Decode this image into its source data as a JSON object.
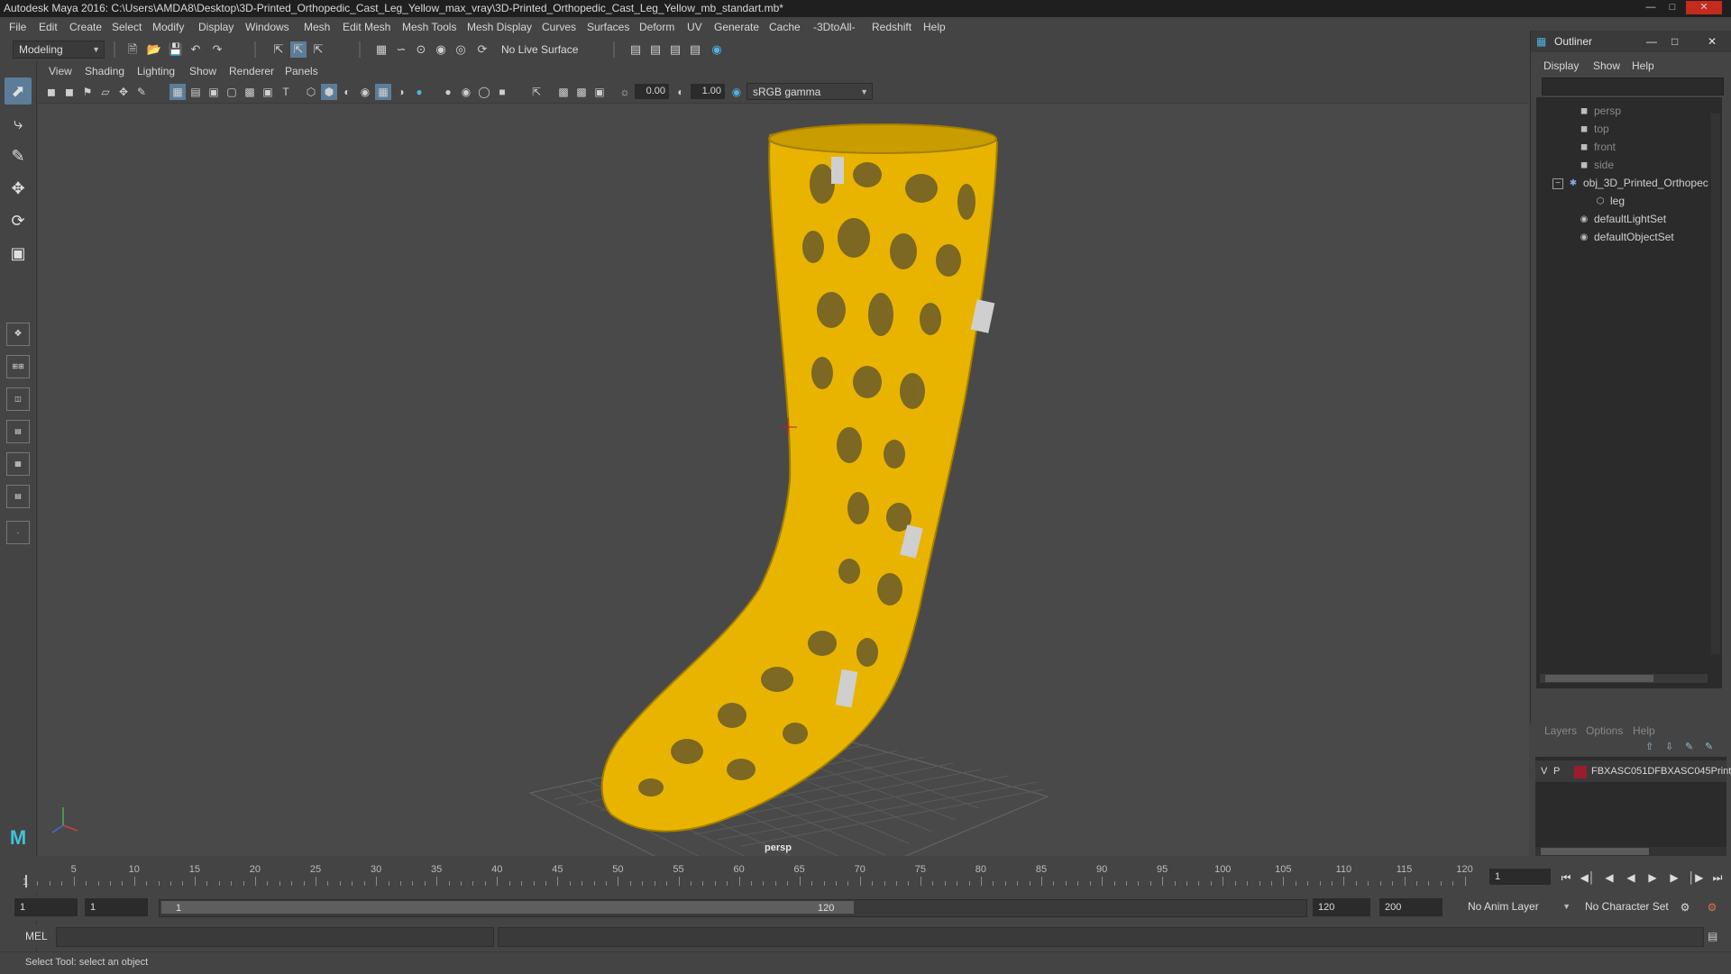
{
  "window": {
    "title": "Autodesk Maya 2016: C:\\Users\\AMDA8\\Desktop\\3D-Printed_Orthopedic_Cast_Leg_Yellow_max_vray\\3D-Printed_Orthopedic_Cast_Leg_Yellow_mb_standart.mb*"
  },
  "menu": [
    "File",
    "Edit",
    "Create",
    "Select",
    "Modify",
    "Display",
    "Windows",
    "Mesh",
    "Edit Mesh",
    "Mesh Tools",
    "Mesh Display",
    "Curves",
    "Surfaces",
    "Deform",
    "UV",
    "Generate",
    "Cache",
    "-3DtoAll-",
    "Redshift",
    "Help"
  ],
  "statusline": {
    "mode": "Modeling",
    "live_surface": "No Live Surface"
  },
  "viewport": {
    "menu": [
      "View",
      "Shading",
      "Lighting",
      "Show",
      "Renderer",
      "Panels"
    ],
    "exposure": "0.00",
    "gamma": "1.00",
    "color_space": "sRGB gamma",
    "camera": "persp",
    "model_color": "#e8b400"
  },
  "outliner": {
    "title": "Outliner",
    "menu": [
      "Display",
      "Show",
      "Help"
    ],
    "items": [
      {
        "label": "persp",
        "icon": "camera-icon",
        "dim": true
      },
      {
        "label": "top",
        "icon": "camera-icon",
        "dim": true
      },
      {
        "label": "front",
        "icon": "camera-icon",
        "dim": true
      },
      {
        "label": "side",
        "icon": "camera-icon",
        "dim": true
      },
      {
        "label": "obj_3D_Printed_Orthopec",
        "icon": "group-icon",
        "dim": false
      },
      {
        "label": "leg",
        "icon": "mesh-icon",
        "dim": false
      },
      {
        "label": "defaultLightSet",
        "icon": "set-icon",
        "dim": false
      },
      {
        "label": "defaultObjectSet",
        "icon": "set-icon",
        "dim": false
      }
    ]
  },
  "layers": {
    "menu": [
      "Layers",
      "Options",
      "Help"
    ],
    "layer": {
      "v": "V",
      "p": "P",
      "name": "FBXASC051DFBXASC045Print",
      "color": "#9a1c2e"
    }
  },
  "timeline": {
    "ticks": [
      5,
      10,
      15,
      20,
      25,
      30,
      35,
      40,
      45,
      50,
      55,
      60,
      65,
      70,
      75,
      80,
      85,
      90,
      95,
      100,
      105,
      110,
      115,
      120
    ],
    "start_label": "1",
    "current_frame": "1"
  },
  "range": {
    "start": "1",
    "playback_start": "1",
    "range_start": "1",
    "range_end": "120",
    "playback_end": "120",
    "end": "200",
    "anim_layer": "No Anim Layer",
    "character_set": "No Character Set"
  },
  "cmdline": {
    "label": "MEL"
  },
  "help": {
    "message": "Select Tool: select an object"
  }
}
